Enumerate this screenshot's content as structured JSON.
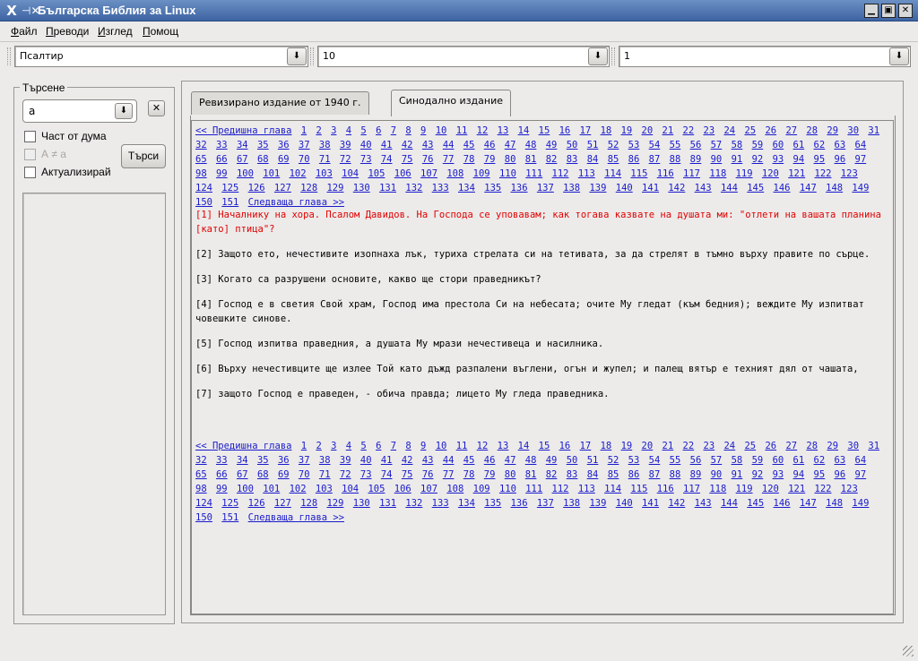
{
  "window": {
    "title": "Българска Библия за Linux",
    "logo_glyph": "X",
    "pin_glyph": "⊣✕",
    "controls": [
      "▁",
      "▣",
      "✕"
    ]
  },
  "menu": [
    "Файл",
    "Преводи",
    "Изглед",
    "Помощ"
  ],
  "selectors": {
    "book": "Псалтир",
    "chapter": "10",
    "verse": "1",
    "arrow_glyph": "⬇"
  },
  "search": {
    "legend": "Търсене",
    "query": "а",
    "clear_glyph": "✕",
    "options": [
      {
        "label": "Част от дума",
        "checked": false,
        "enabled": true
      },
      {
        "label": "А ≠ а",
        "checked": false,
        "enabled": false
      },
      {
        "label": "Актуализирай",
        "checked": false,
        "enabled": true
      }
    ],
    "search_button": "Търси"
  },
  "tabs": [
    {
      "label": "Ревизирано издание от 1940 г.",
      "active": false
    },
    {
      "label": "Синодално издание",
      "active": true
    }
  ],
  "nav": {
    "prev": "<< Предишна глава",
    "next": "Следваща глава >>",
    "chapter_count": 151
  },
  "verses": [
    {
      "num": "[1]",
      "text": "Началнику на хора. Псалом Давидов. На Господа се уповавам; как тогава казвате на душата ми: \"отлети на вашата планина [като] птица\"?",
      "highlight": true
    },
    {
      "num": "[2]",
      "text": "Защото ето, нечестивите изопнаха лък, туриха стрелата си на тетивата, за да стрелят в тъмно върху правите по сърце.",
      "highlight": false
    },
    {
      "num": "[3]",
      "text": "Когато са разрушени основите, какво ще стори праведникът?",
      "highlight": false
    },
    {
      "num": "[4]",
      "text": "Господ е в светия Свой храм, Господ има престола Си на небесата; очите Му гледат (към бедния); веждите Му изпитват човешките синове.",
      "highlight": false
    },
    {
      "num": "[5]",
      "text": "Господ изпитва праведния, а душата Му мрази нечестивеца и насилника.",
      "highlight": false
    },
    {
      "num": "[6]",
      "text": "Върху нечестивците ще излее Той като дъжд разпалени въглени, огън и жупел; и палещ вятър е техният дял от чашата,",
      "highlight": false
    },
    {
      "num": "[7]",
      "text": "защото Господ е праведен, - обича правда; лицето Му гледа праведника.",
      "highlight": false
    }
  ]
}
